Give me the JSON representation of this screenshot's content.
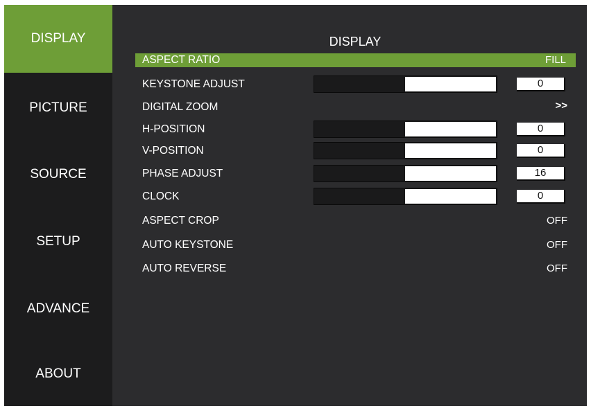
{
  "sidebar": {
    "items": [
      {
        "label": "DISPLAY",
        "active": true
      },
      {
        "label": "PICTURE",
        "active": false
      },
      {
        "label": "SOURCE",
        "active": false
      },
      {
        "label": "SETUP",
        "active": false
      },
      {
        "label": "ADVANCE",
        "active": false
      },
      {
        "label": "ABOUT",
        "active": false
      }
    ]
  },
  "panel": {
    "title": "DISPLAY",
    "rows": [
      {
        "label": "ASPECT RATIO",
        "value": "FILL",
        "selected": true
      },
      {
        "label": "KEYSTONE ADJUST",
        "value": "0",
        "slider_fraction": 0.5
      },
      {
        "label": "DIGITAL ZOOM",
        "arrow": ">>"
      },
      {
        "label": "H-POSITION",
        "value": "0",
        "slider_fraction": 0.5
      },
      {
        "label": "V-POSITION",
        "value": "0",
        "slider_fraction": 0.5
      },
      {
        "label": "PHASE ADJUST",
        "value": "16",
        "slider_fraction": 0.5
      },
      {
        "label": "CLOCK",
        "value": "0",
        "slider_fraction": 0.5
      },
      {
        "label": "ASPECT CROP",
        "value": "OFF"
      },
      {
        "label": "AUTO KEYSTONE",
        "value": "OFF"
      },
      {
        "label": "AUTO REVERSE",
        "value": "OFF"
      }
    ]
  },
  "colors": {
    "accent": "#6e9e37",
    "sidebar_bg": "#1c1c1d",
    "panel_bg": "#2c2c2e",
    "slider_bg": "#1a1a1b",
    "slider_fill": "#ffffff"
  }
}
